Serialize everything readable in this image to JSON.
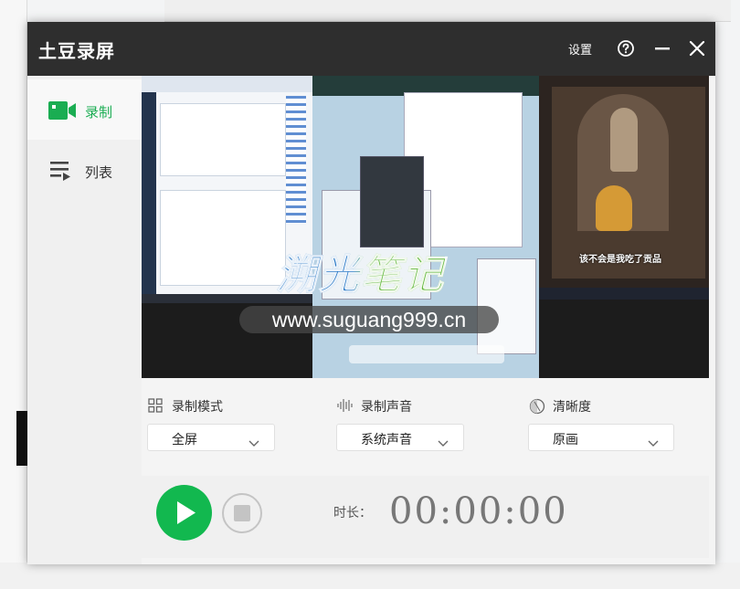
{
  "app": {
    "title": "土豆录屏",
    "settings_label": "设置",
    "accent_color": "#1aad52"
  },
  "sidebar": {
    "items": [
      {
        "label": "录制",
        "icon": "video-camera-icon",
        "active": true
      },
      {
        "label": "列表",
        "icon": "list-icon",
        "active": false
      }
    ]
  },
  "preview": {
    "watermark_logo": "溯光笔记",
    "watermark_url": "www.suguang999.cn",
    "subtitle": "该不会是我吃了贡品"
  },
  "options": {
    "mode": {
      "label": "录制模式",
      "value": "全屏",
      "icon": "grid-icon"
    },
    "audio": {
      "label": "录制声音",
      "value": "系统声音",
      "icon": "sound-wave-icon"
    },
    "quality": {
      "label": "清晰度",
      "value": "原画",
      "icon": "quality-circle-icon"
    }
  },
  "controls": {
    "duration_label": "时长：",
    "duration_value": "00:00:00"
  }
}
